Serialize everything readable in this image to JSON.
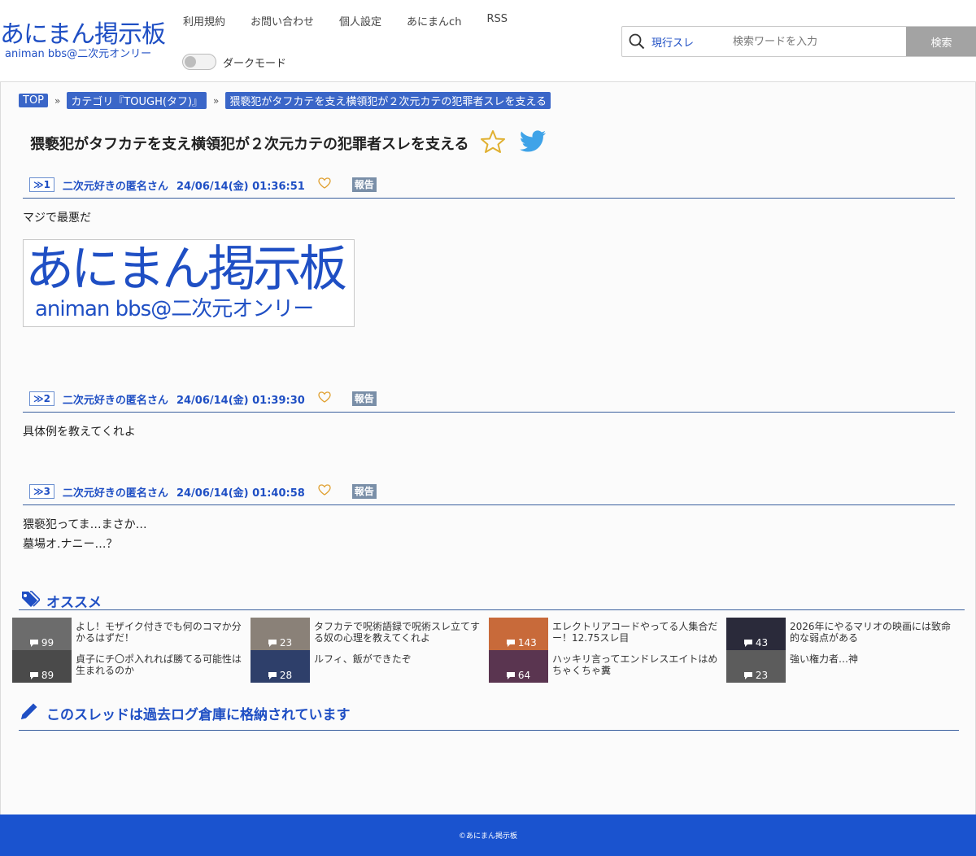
{
  "header": {
    "logo_main": "あにまん掲示板",
    "logo_sub": "animan bbs@二次元オンリー",
    "nav": [
      "利用規約",
      "お問い合わせ",
      "個人設定",
      "あにまんch",
      "RSS"
    ],
    "dark_mode_label": "ダークモード",
    "search_scope": "現行スレ",
    "search_placeholder": "検索ワードを入力",
    "search_button": "検索"
  },
  "breadcrumb": [
    "TOP",
    "カテゴリ『TOUGH(タフ)』",
    "猥褻犯がタフカテを支え横領犯が２次元カテの犯罪者スレを支える"
  ],
  "breadcrumb_sep": "»",
  "thread": {
    "title": "猥褻犯がタフカテを支え横領犯が２次元カテの犯罪者スレを支える"
  },
  "posts": [
    {
      "no": "≫1",
      "name": "二次元好きの匿名さん",
      "date": "24/06/14(金) 01:36:51",
      "report": "報告",
      "lines": [
        "マジで最悪だ"
      ],
      "image": {
        "line1": "あにまん掲示板",
        "line2": "animan bbs@二次元オンリー"
      }
    },
    {
      "no": "≫2",
      "name": "二次元好きの匿名さん",
      "date": "24/06/14(金) 01:39:30",
      "report": "報告",
      "lines": [
        "具体例を教えてくれよ"
      ]
    },
    {
      "no": "≫3",
      "name": "二次元好きの匿名さん",
      "date": "24/06/14(金) 01:40:58",
      "report": "報告",
      "lines": [
        "猥褻犯ってま…まさか…",
        "墓場オ.ナニー…？"
      ]
    }
  ],
  "recommend": {
    "heading": "オススメ",
    "items": [
      {
        "count": "99",
        "title": "よし！モザイク付きでも何のコマか分かるはずだ！",
        "color": "#6c6c6c"
      },
      {
        "count": "23",
        "title": "タフカテで呪術語録で呪術スレ立てする奴の心理を教えてくれよ",
        "color": "#8a8178"
      },
      {
        "count": "143",
        "title": "エレクトリアコードやってる人集合だー！12.75スレ目",
        "color": "#c86a3a"
      },
      {
        "count": "43",
        "title": "2026年にやるマリオの映画には致命的な弱点がある",
        "color": "#2a2a3a"
      },
      {
        "count": "89",
        "title": "貞子にチ〇ポ入れれば勝てる可能性は生まれるのか",
        "color": "#4a4a4a"
      },
      {
        "count": "28",
        "title": "ルフィ、飯ができたぞ",
        "color": "#2e3f6a"
      },
      {
        "count": "64",
        "title": "ハッキリ言ってエンドレスエイトはめちゃくちゃ糞",
        "color": "#5a3550"
      },
      {
        "count": "23",
        "title": "強い権力者…神",
        "color": "#5c5c5c"
      }
    ]
  },
  "archive_notice": "このスレッドは過去ログ倉庫に格納されています",
  "footer": "©あにまん掲示板"
}
